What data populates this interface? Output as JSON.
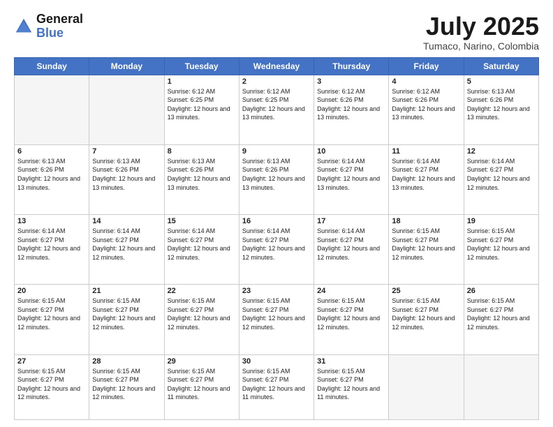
{
  "header": {
    "logo_line1": "General",
    "logo_line2": "Blue",
    "month_title": "July 2025",
    "location": "Tumaco, Narino, Colombia"
  },
  "weekdays": [
    "Sunday",
    "Monday",
    "Tuesday",
    "Wednesday",
    "Thursday",
    "Friday",
    "Saturday"
  ],
  "weeks": [
    [
      {
        "day": "",
        "empty": true
      },
      {
        "day": "",
        "empty": true
      },
      {
        "day": "1",
        "sunrise": "6:12 AM",
        "sunset": "6:25 PM",
        "daylight": "12 hours and 13 minutes."
      },
      {
        "day": "2",
        "sunrise": "6:12 AM",
        "sunset": "6:25 PM",
        "daylight": "12 hours and 13 minutes."
      },
      {
        "day": "3",
        "sunrise": "6:12 AM",
        "sunset": "6:26 PM",
        "daylight": "12 hours and 13 minutes."
      },
      {
        "day": "4",
        "sunrise": "6:12 AM",
        "sunset": "6:26 PM",
        "daylight": "12 hours and 13 minutes."
      },
      {
        "day": "5",
        "sunrise": "6:13 AM",
        "sunset": "6:26 PM",
        "daylight": "12 hours and 13 minutes."
      }
    ],
    [
      {
        "day": "6",
        "sunrise": "6:13 AM",
        "sunset": "6:26 PM",
        "daylight": "12 hours and 13 minutes."
      },
      {
        "day": "7",
        "sunrise": "6:13 AM",
        "sunset": "6:26 PM",
        "daylight": "12 hours and 13 minutes."
      },
      {
        "day": "8",
        "sunrise": "6:13 AM",
        "sunset": "6:26 PM",
        "daylight": "12 hours and 13 minutes."
      },
      {
        "day": "9",
        "sunrise": "6:13 AM",
        "sunset": "6:26 PM",
        "daylight": "12 hours and 13 minutes."
      },
      {
        "day": "10",
        "sunrise": "6:14 AM",
        "sunset": "6:27 PM",
        "daylight": "12 hours and 13 minutes."
      },
      {
        "day": "11",
        "sunrise": "6:14 AM",
        "sunset": "6:27 PM",
        "daylight": "12 hours and 13 minutes."
      },
      {
        "day": "12",
        "sunrise": "6:14 AM",
        "sunset": "6:27 PM",
        "daylight": "12 hours and 12 minutes."
      }
    ],
    [
      {
        "day": "13",
        "sunrise": "6:14 AM",
        "sunset": "6:27 PM",
        "daylight": "12 hours and 12 minutes."
      },
      {
        "day": "14",
        "sunrise": "6:14 AM",
        "sunset": "6:27 PM",
        "daylight": "12 hours and 12 minutes."
      },
      {
        "day": "15",
        "sunrise": "6:14 AM",
        "sunset": "6:27 PM",
        "daylight": "12 hours and 12 minutes."
      },
      {
        "day": "16",
        "sunrise": "6:14 AM",
        "sunset": "6:27 PM",
        "daylight": "12 hours and 12 minutes."
      },
      {
        "day": "17",
        "sunrise": "6:14 AM",
        "sunset": "6:27 PM",
        "daylight": "12 hours and 12 minutes."
      },
      {
        "day": "18",
        "sunrise": "6:15 AM",
        "sunset": "6:27 PM",
        "daylight": "12 hours and 12 minutes."
      },
      {
        "day": "19",
        "sunrise": "6:15 AM",
        "sunset": "6:27 PM",
        "daylight": "12 hours and 12 minutes."
      }
    ],
    [
      {
        "day": "20",
        "sunrise": "6:15 AM",
        "sunset": "6:27 PM",
        "daylight": "12 hours and 12 minutes."
      },
      {
        "day": "21",
        "sunrise": "6:15 AM",
        "sunset": "6:27 PM",
        "daylight": "12 hours and 12 minutes."
      },
      {
        "day": "22",
        "sunrise": "6:15 AM",
        "sunset": "6:27 PM",
        "daylight": "12 hours and 12 minutes."
      },
      {
        "day": "23",
        "sunrise": "6:15 AM",
        "sunset": "6:27 PM",
        "daylight": "12 hours and 12 minutes."
      },
      {
        "day": "24",
        "sunrise": "6:15 AM",
        "sunset": "6:27 PM",
        "daylight": "12 hours and 12 minutes."
      },
      {
        "day": "25",
        "sunrise": "6:15 AM",
        "sunset": "6:27 PM",
        "daylight": "12 hours and 12 minutes."
      },
      {
        "day": "26",
        "sunrise": "6:15 AM",
        "sunset": "6:27 PM",
        "daylight": "12 hours and 12 minutes."
      }
    ],
    [
      {
        "day": "27",
        "sunrise": "6:15 AM",
        "sunset": "6:27 PM",
        "daylight": "12 hours and 12 minutes."
      },
      {
        "day": "28",
        "sunrise": "6:15 AM",
        "sunset": "6:27 PM",
        "daylight": "12 hours and 12 minutes."
      },
      {
        "day": "29",
        "sunrise": "6:15 AM",
        "sunset": "6:27 PM",
        "daylight": "12 hours and 11 minutes."
      },
      {
        "day": "30",
        "sunrise": "6:15 AM",
        "sunset": "6:27 PM",
        "daylight": "12 hours and 11 minutes."
      },
      {
        "day": "31",
        "sunrise": "6:15 AM",
        "sunset": "6:27 PM",
        "daylight": "12 hours and 11 minutes."
      },
      {
        "day": "",
        "empty": true
      },
      {
        "day": "",
        "empty": true
      }
    ]
  ],
  "labels": {
    "sunrise_prefix": "Sunrise: ",
    "sunset_prefix": "Sunset: ",
    "daylight_prefix": "Daylight: "
  }
}
